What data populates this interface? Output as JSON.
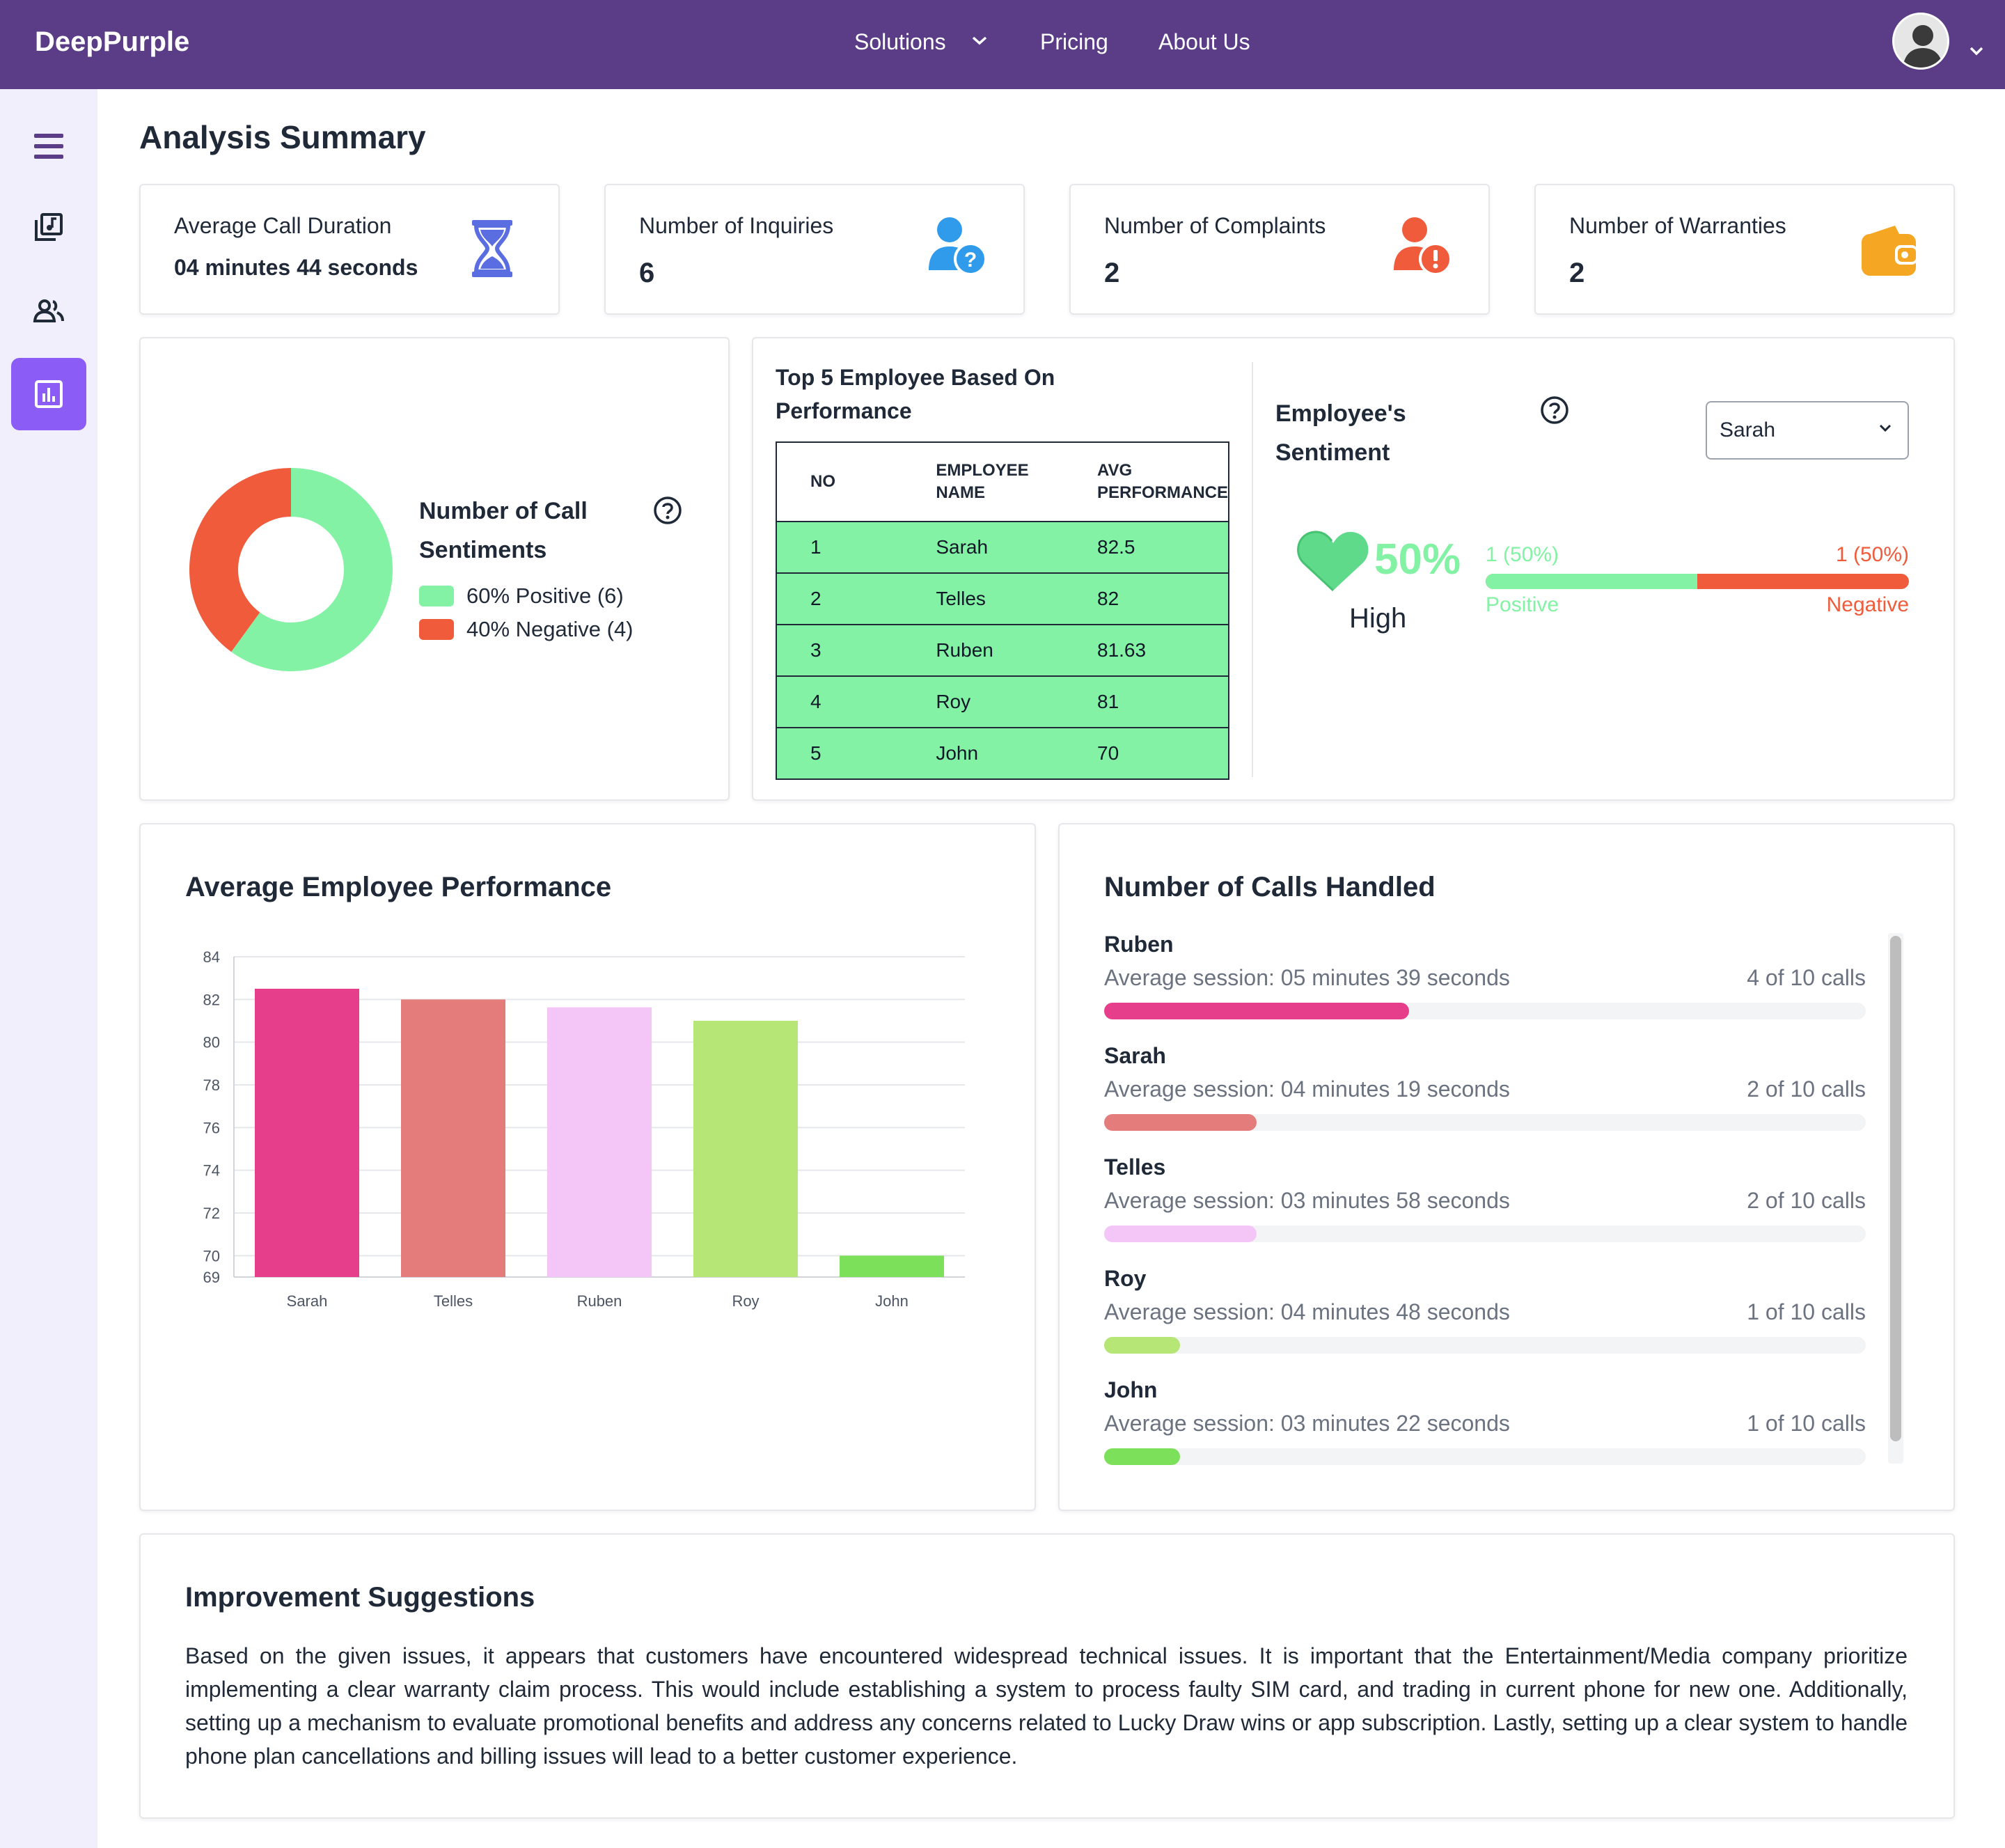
{
  "app": {
    "brand": "DeepPurple"
  },
  "nav": {
    "solutions": "Solutions",
    "pricing": "Pricing",
    "about": "About Us"
  },
  "sidebar": {
    "items": [
      "menu-icon",
      "music-library-icon",
      "users-icon",
      "analytics-icon"
    ],
    "active": "analytics"
  },
  "page": {
    "title": "Analysis Summary"
  },
  "stats": [
    {
      "label": "Average Call Duration",
      "value": "04 minutes 44 seconds",
      "icon": "hourglass-icon",
      "color": "#5b6ee1"
    },
    {
      "label": "Number of Inquiries",
      "value": "6",
      "icon": "user-question-icon",
      "color": "#2f9bea"
    },
    {
      "label": "Number of Complaints",
      "value": "2",
      "icon": "user-alert-icon",
      "color": "#ef5b3b"
    },
    {
      "label": "Number of Warranties",
      "value": "2",
      "icon": "wallet-icon",
      "color": "#f5a623"
    }
  ],
  "sentiments": {
    "title_line1": "Number of Call",
    "title_line2": "Sentiments",
    "positive_label": "60% Positive (6)",
    "negative_label": "40% Negative (4)",
    "positive_pct": 60,
    "negative_pct": 40,
    "positive_color": "#83f2a5",
    "negative_color": "#ef5b3b"
  },
  "top5": {
    "title_line1": "Top 5 Employee Based On",
    "title_line2": "Performance",
    "headers": [
      "NO",
      "EMPLOYEE NAME",
      "AVG PERFORMANCE"
    ],
    "rows": [
      {
        "no": "1",
        "name": "Sarah",
        "perf": "82.5"
      },
      {
        "no": "2",
        "name": "Telles",
        "perf": "82"
      },
      {
        "no": "3",
        "name": "Ruben",
        "perf": "81.63"
      },
      {
        "no": "4",
        "name": "Roy",
        "perf": "81"
      },
      {
        "no": "5",
        "name": "John",
        "perf": "70"
      }
    ]
  },
  "employee_sentiment": {
    "title_line1": "Employee's",
    "title_line2": "Sentiment",
    "selected": "Sarah",
    "percent": "50%",
    "level": "High",
    "positive_count": "1 (50%)",
    "negative_count": "1 (50%)",
    "positive_label": "Positive",
    "negative_label": "Negative",
    "positive_fraction": 0.5
  },
  "performance_chart": {
    "title": "Average Employee Performance"
  },
  "chart_data": {
    "type": "bar",
    "categories": [
      "Sarah",
      "Telles",
      "Ruben",
      "Roy",
      "John"
    ],
    "values": [
      82.5,
      82,
      81.63,
      81,
      70
    ],
    "colors": [
      "#e63e8a",
      "#e47c7c",
      "#f4c6f8",
      "#b6e676",
      "#7de05a"
    ],
    "ylim": [
      69,
      84
    ],
    "yticks": [
      84,
      82,
      80,
      78,
      76,
      74,
      72,
      70,
      69
    ],
    "grid": true,
    "title": "",
    "xlabel": "",
    "ylabel": ""
  },
  "calls": {
    "title": "Number of Calls Handled",
    "items": [
      {
        "name": "Ruben",
        "session": "Average session: 05 minutes 39 seconds",
        "count": "4 of 10 calls",
        "fraction": 0.4,
        "color": "#e63e8a"
      },
      {
        "name": "Sarah",
        "session": "Average session: 04 minutes 19 seconds",
        "count": "2 of 10 calls",
        "fraction": 0.2,
        "color": "#e47c7c"
      },
      {
        "name": "Telles",
        "session": "Average session: 03 minutes 58 seconds",
        "count": "2 of 10 calls",
        "fraction": 0.2,
        "color": "#f4c6f8"
      },
      {
        "name": "Roy",
        "session": "Average session: 04 minutes 48 seconds",
        "count": "1 of 10 calls",
        "fraction": 0.1,
        "color": "#b6e676"
      },
      {
        "name": "John",
        "session": "Average session: 03 minutes 22 seconds",
        "count": "1 of 10 calls",
        "fraction": 0.1,
        "color": "#7de05a"
      }
    ]
  },
  "suggestions": {
    "title": "Improvement Suggestions",
    "text": "Based on the given issues, it appears that customers have encountered widespread technical issues. It is important that the Entertainment/Media company prioritize implementing a clear warranty claim process. This would include establishing a system to process faulty SIM card, and trading in current phone for new one. Additionally, setting up a mechanism to evaluate promotional benefits and address any concerns related to Lucky Draw wins or app subscription. Lastly, setting up a clear system to handle phone plan cancellations and billing issues will lead to a better customer experience."
  }
}
